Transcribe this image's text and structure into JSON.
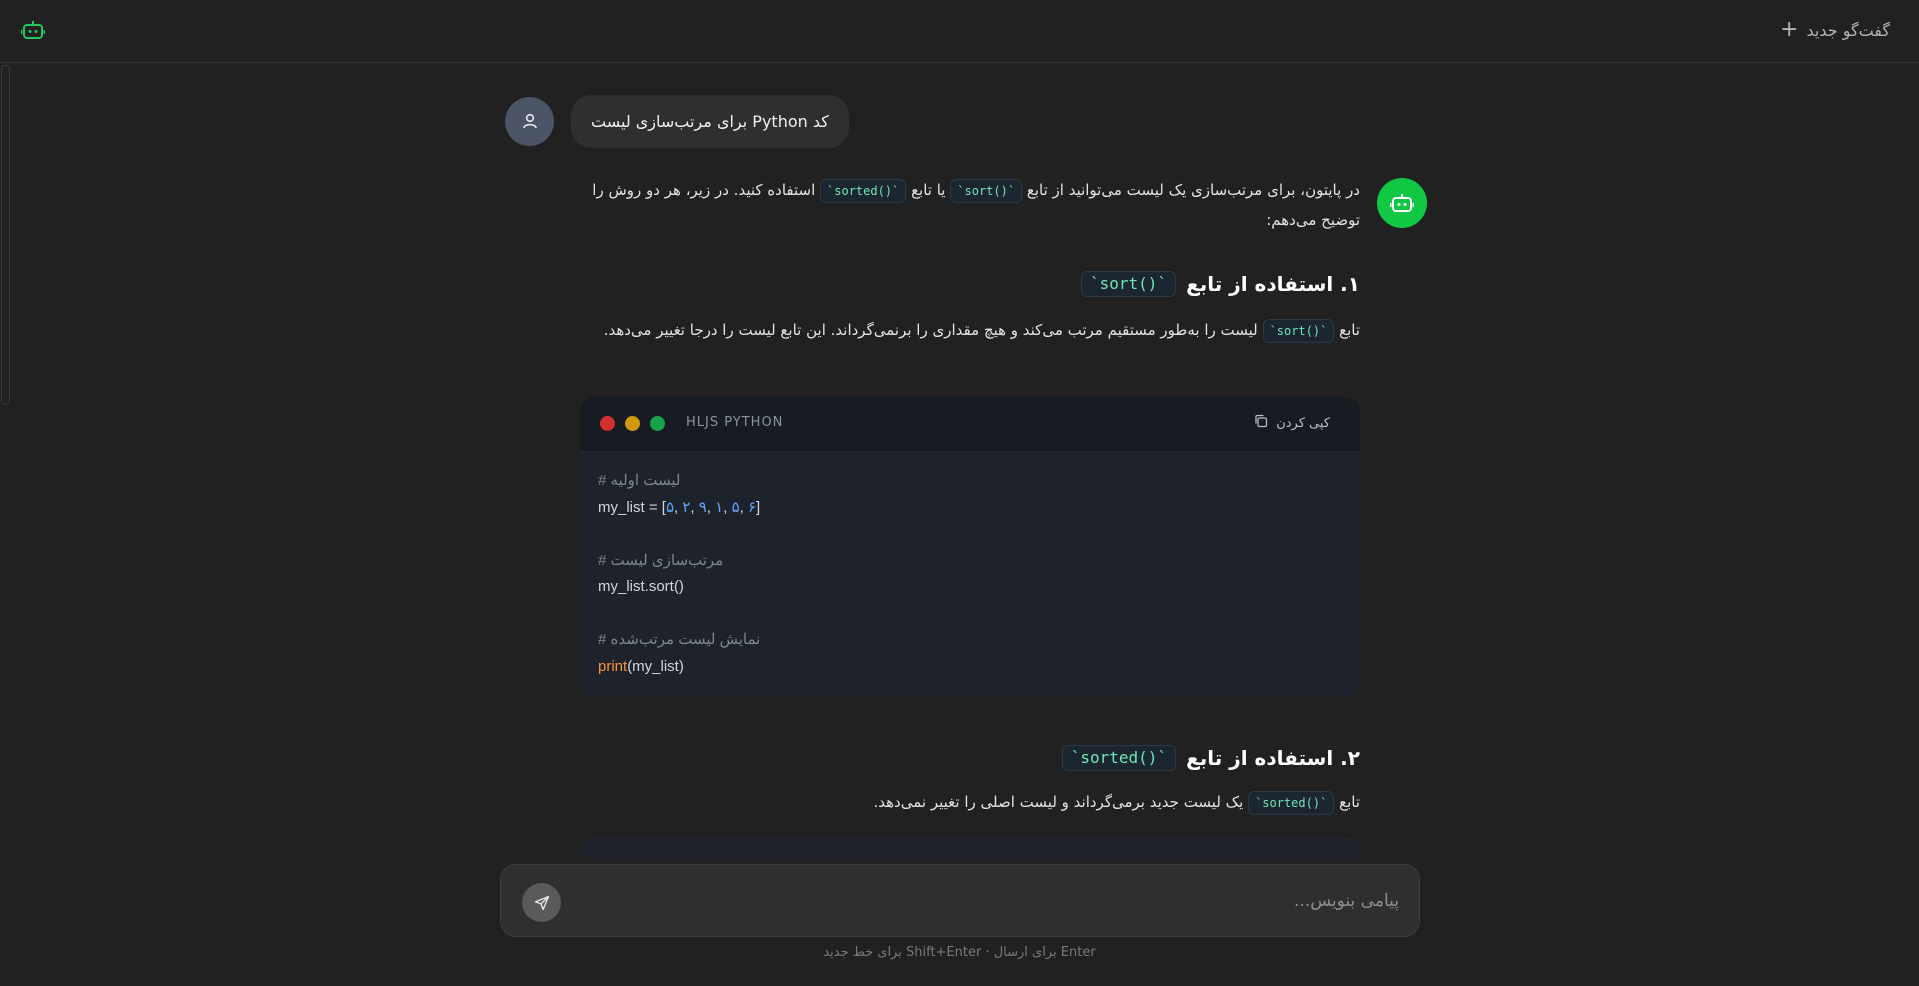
{
  "header": {
    "new_chat_label": "گفت‌گو جدید",
    "logo_icon": "robot-icon",
    "new_chat_icon": "plus-icon"
  },
  "user_message": {
    "text": "کد Python برای مرتب‌سازی لیست",
    "avatar_icon": "user-icon"
  },
  "assistant": {
    "avatar_icon": "robot-icon",
    "intro": {
      "part1": "در پایتون، برای مرتب‌سازی یک لیست می‌توانید از تابع",
      "code1": "`sort()`",
      "part2": "یا تابع",
      "code2": "`sorted()`",
      "part3": "استفاده کنید. در زیر، هر دو روش را توضیح می‌دهم:"
    },
    "section1": {
      "heading": "۱. استفاده از تابع",
      "heading_code": "`sort()`",
      "text_prefix": "تابع",
      "text_code": "`sort()`",
      "text": "لیست را به‌طور مستقیم مرتب می‌کند و هیچ مقداری را برنمی‌گرداند. این تابع لیست را درجا تغییر می‌دهد."
    },
    "code_block": {
      "language": "HLJS PYTHON",
      "copy_label": "کپی کردن",
      "copy_icon": "copy-icon",
      "comment1": "# لیست اولیه",
      "line2_prefix": "my_list = [",
      "numbers": [
        "۵",
        "۲",
        "۹",
        "۱",
        "۵",
        "۶"
      ],
      "line2_suffix": "]",
      "comment2": "# مرتب‌سازی لیست",
      "line4": "my_list.sort()",
      "comment3": "# نمایش لیست مرتب‌شده",
      "line6_fn": "print",
      "line6_rest": "(my_list)"
    },
    "section2": {
      "heading": "۲. استفاده از تابع",
      "heading_code": "`sorted()`",
      "text_prefix": "تابع",
      "text_code": "`sorted()`",
      "text": "یک لیست جدید برمی‌گرداند و لیست اصلی را تغییر نمی‌دهد."
    }
  },
  "composer": {
    "placeholder": "پیامی بنویس...",
    "send_icon": "send-icon",
    "hint": "Enter برای ارسال · Shift+Enter برای خط جدید"
  },
  "colors": {
    "background": "#212121",
    "accent": "#10c843",
    "inline_code": "#6ee7b7",
    "code_number": "#60a5fa",
    "code_function": "#fb923c"
  }
}
